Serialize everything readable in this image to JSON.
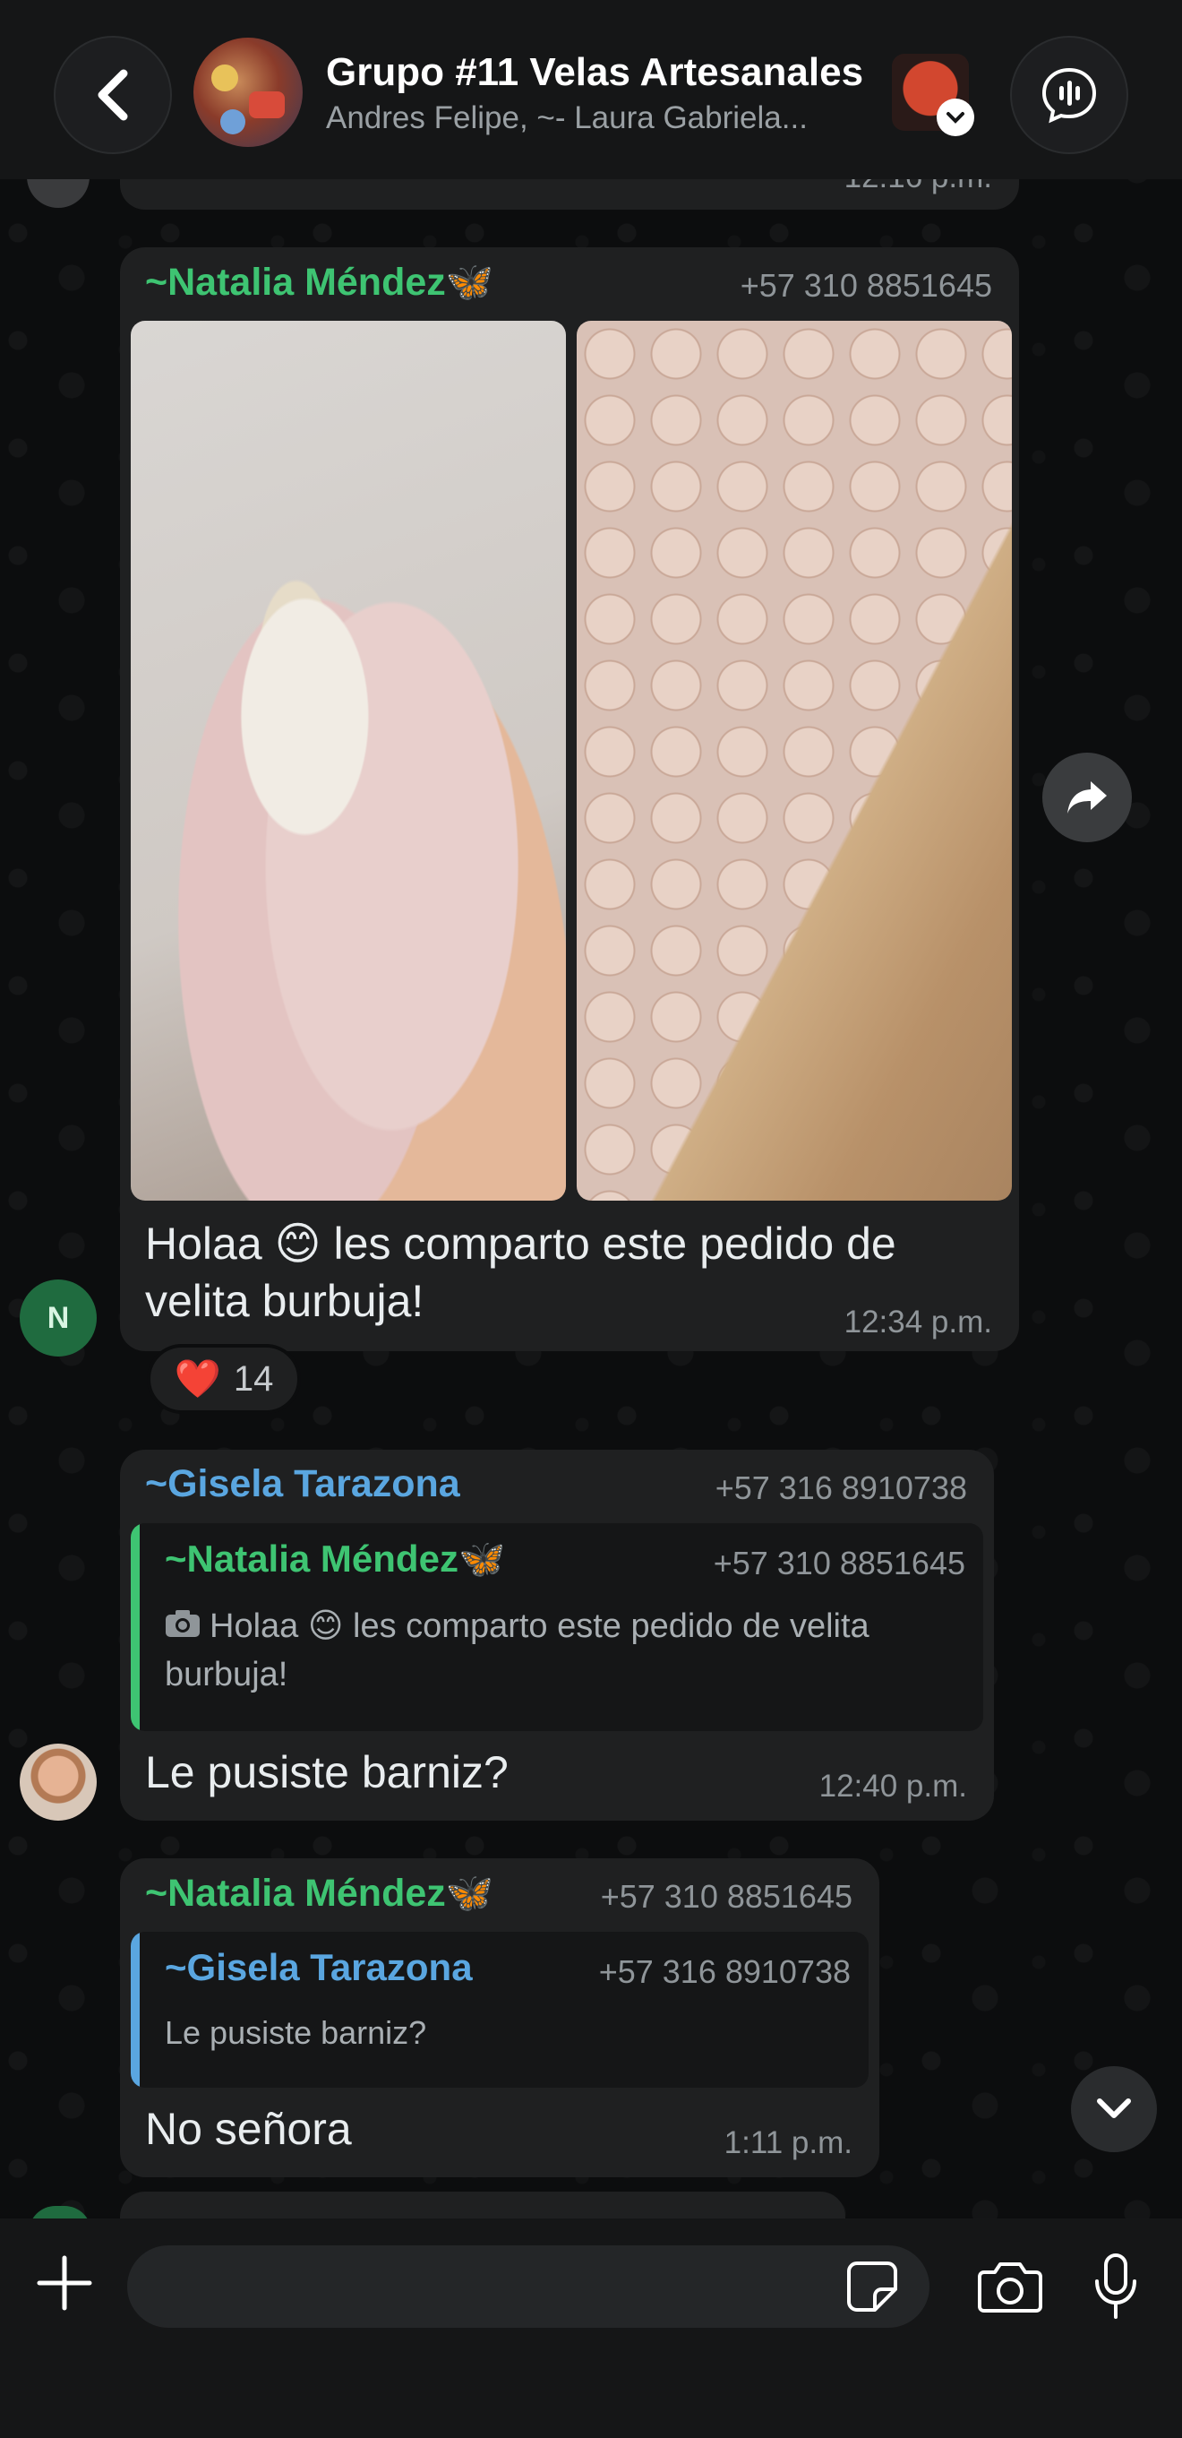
{
  "header": {
    "title": "Grupo #11 Velas Artesanales",
    "subtitle": "Andres Felipe, ~- Laura Gabriela..."
  },
  "previous_message": {
    "time": "12:16 p.m."
  },
  "message1": {
    "sender": "~Natalia Méndez🦋",
    "phone": "+57 310 8851645",
    "text": "Holaa 😊 les comparto este pedido de velita burbuja!",
    "time": "12:34 p.m.",
    "avatar_initial": "N",
    "reaction_emoji": "❤️",
    "reaction_count": "14"
  },
  "message2": {
    "sender": "~Gisela Tarazona",
    "phone": "+57 316 8910738",
    "quote_sender": "~Natalia Méndez🦋",
    "quote_phone": "+57 310 8851645",
    "quote_text": "Holaa 😊 les comparto este pedido de velita burbuja!",
    "text": "Le pusiste barniz?",
    "time": "12:40 p.m."
  },
  "message3": {
    "sender": "~Natalia Méndez🦋",
    "phone": "+57 310 8851645",
    "quote_sender": "~Gisela Tarazona",
    "quote_phone": "+57 316 8910738",
    "quote_text": "Le pusiste barniz?",
    "text": "No señora",
    "time": "1:11 p.m."
  },
  "composer": {
    "placeholder": ""
  },
  "colors": {
    "green_sender": "#3ec472",
    "blue_sender": "#5aa6e0",
    "bubble": "#1f2021",
    "background": "#0c0d0e"
  }
}
